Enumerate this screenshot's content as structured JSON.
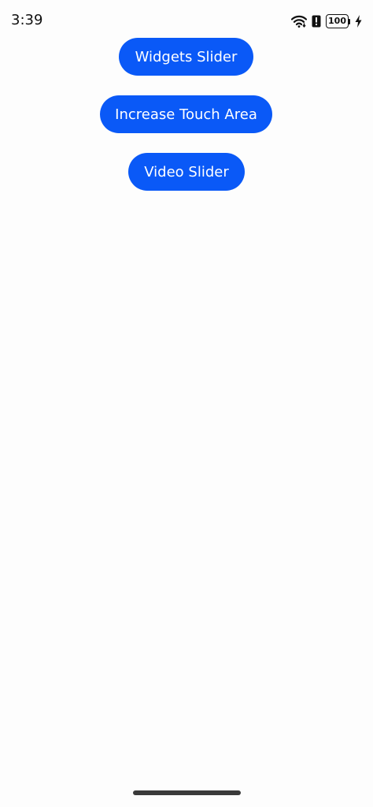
{
  "status_bar": {
    "time": "3:39",
    "battery_level": "100",
    "icons": [
      "wifi-icon",
      "alert-icon",
      "battery-icon",
      "charging-bolt-icon"
    ]
  },
  "buttons": {
    "widgets_slider": "Widgets Slider",
    "increase_touch_area": "Increase Touch Area",
    "video_slider": "Video Slider"
  },
  "colors": {
    "background": "#fdfdfd",
    "button_bg": "#0a59f7",
    "button_text": "#ffffff"
  }
}
